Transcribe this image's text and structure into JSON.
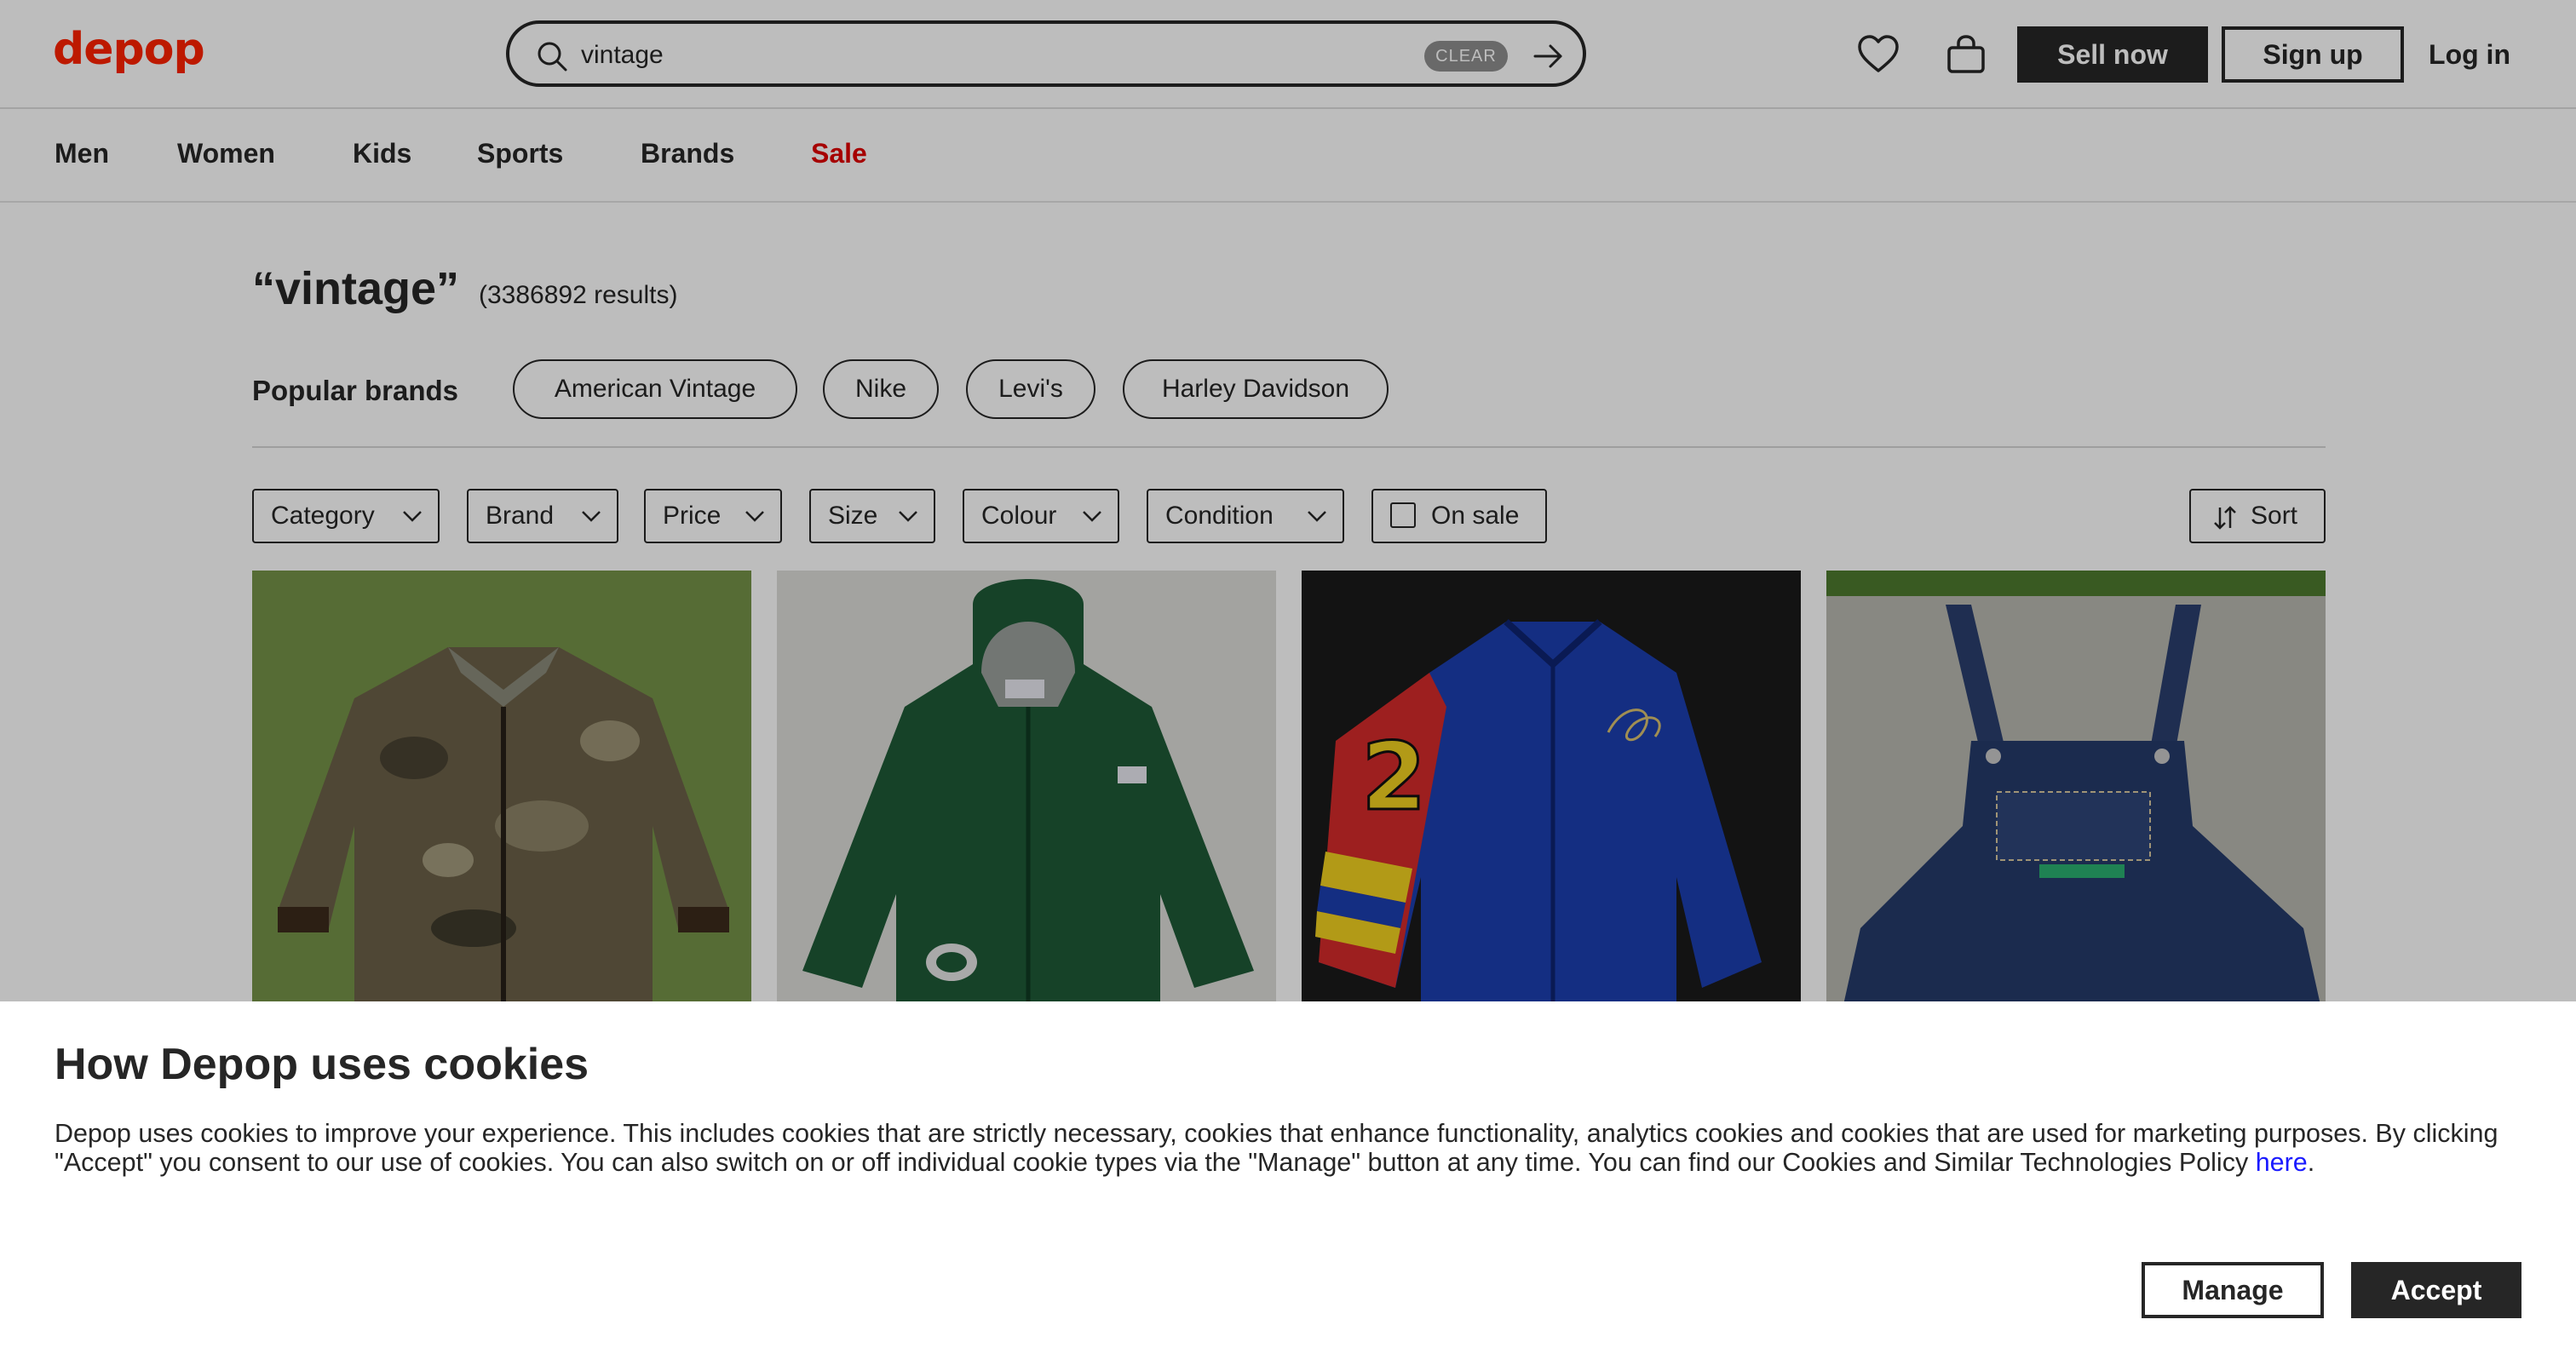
{
  "header": {
    "logo": "depop",
    "search": {
      "value": "vintage",
      "clear_label": "CLEAR"
    },
    "sell_label": "Sell now",
    "signup_label": "Sign up",
    "login_label": "Log in"
  },
  "nav": {
    "items": [
      {
        "label": "Men"
      },
      {
        "label": "Women"
      },
      {
        "label": "Kids"
      },
      {
        "label": "Sports"
      },
      {
        "label": "Brands"
      },
      {
        "label": "Sale"
      }
    ]
  },
  "results": {
    "query": "“vintage”",
    "count": "(3386892 results)"
  },
  "popular_brands": {
    "label": "Popular brands",
    "brands": [
      "American Vintage",
      "Nike",
      "Levi's",
      "Harley Davidson"
    ]
  },
  "filters": {
    "items": [
      "Category",
      "Brand",
      "Price",
      "Size",
      "Colour",
      "Condition"
    ],
    "on_sale_label": "On sale",
    "sort_label": "Sort"
  },
  "products": [
    {
      "icon": "camo-jacket-image"
    },
    {
      "icon": "green-hooded-jacket-image"
    },
    {
      "icon": "blue-racing-jacket-image"
    },
    {
      "icon": "denim-overalls-image"
    }
  ],
  "cookie_banner": {
    "title": "How Depop uses cookies",
    "body": "Depop uses cookies to improve your experience. This includes cookies that are strictly necessary, cookies that enhance functionality, analytics cookies and cookies that are used for marketing purposes. By clicking \"Accept\" you consent to our use of cookies. You can also switch on or off individual cookie types via the \"Manage\" button at any time. You can find our Cookies and Similar Technologies Policy",
    "link_label": "here",
    "manage_label": "Manage",
    "accept_label": "Accept"
  },
  "colors": {
    "brand": "#ff2300",
    "sale": "#e00000",
    "text": "#262626",
    "link": "#1a1aff"
  }
}
